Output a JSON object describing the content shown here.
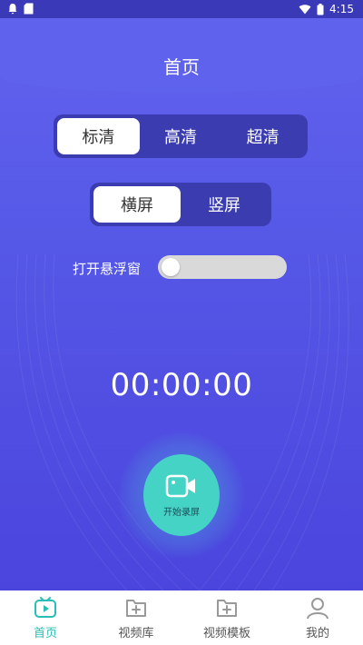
{
  "status_bar": {
    "time": "4:15"
  },
  "header": {
    "title": "首页"
  },
  "quality": {
    "options": [
      "标清",
      "高清",
      "超清"
    ],
    "selected": "标清"
  },
  "orientation": {
    "options": [
      "横屏",
      "竖屏"
    ],
    "selected": "横屏"
  },
  "floating_window": {
    "label": "打开悬浮窗",
    "enabled": false
  },
  "timer": {
    "value": "00:00:00"
  },
  "record_button": {
    "label": "开始录屏"
  },
  "bottom_nav": {
    "items": [
      {
        "label": "首页",
        "icon": "tv-play-icon",
        "active": true
      },
      {
        "label": "视频库",
        "icon": "folder-plus-icon",
        "active": false
      },
      {
        "label": "视频模板",
        "icon": "folder-plus-icon",
        "active": false
      },
      {
        "label": "我的",
        "icon": "user-icon",
        "active": false
      }
    ]
  },
  "colors": {
    "primary_bg": "#5557e6",
    "segment_bg": "#3b3cb0",
    "accent": "#45d3c6",
    "nav_active": "#27bfb5"
  }
}
